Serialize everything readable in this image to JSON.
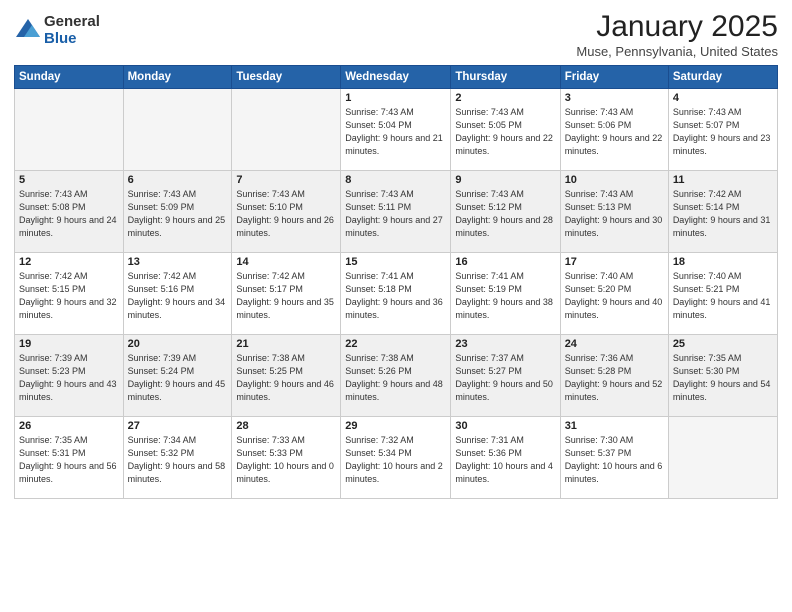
{
  "logo": {
    "general": "General",
    "blue": "Blue"
  },
  "header": {
    "title": "January 2025",
    "location": "Muse, Pennsylvania, United States"
  },
  "weekdays": [
    "Sunday",
    "Monday",
    "Tuesday",
    "Wednesday",
    "Thursday",
    "Friday",
    "Saturday"
  ],
  "weeks": [
    [
      {
        "day": "",
        "info": ""
      },
      {
        "day": "",
        "info": ""
      },
      {
        "day": "",
        "info": ""
      },
      {
        "day": "1",
        "info": "Sunrise: 7:43 AM\nSunset: 5:04 PM\nDaylight: 9 hours\nand 21 minutes."
      },
      {
        "day": "2",
        "info": "Sunrise: 7:43 AM\nSunset: 5:05 PM\nDaylight: 9 hours\nand 22 minutes."
      },
      {
        "day": "3",
        "info": "Sunrise: 7:43 AM\nSunset: 5:06 PM\nDaylight: 9 hours\nand 22 minutes."
      },
      {
        "day": "4",
        "info": "Sunrise: 7:43 AM\nSunset: 5:07 PM\nDaylight: 9 hours\nand 23 minutes."
      }
    ],
    [
      {
        "day": "5",
        "info": "Sunrise: 7:43 AM\nSunset: 5:08 PM\nDaylight: 9 hours\nand 24 minutes."
      },
      {
        "day": "6",
        "info": "Sunrise: 7:43 AM\nSunset: 5:09 PM\nDaylight: 9 hours\nand 25 minutes."
      },
      {
        "day": "7",
        "info": "Sunrise: 7:43 AM\nSunset: 5:10 PM\nDaylight: 9 hours\nand 26 minutes."
      },
      {
        "day": "8",
        "info": "Sunrise: 7:43 AM\nSunset: 5:11 PM\nDaylight: 9 hours\nand 27 minutes."
      },
      {
        "day": "9",
        "info": "Sunrise: 7:43 AM\nSunset: 5:12 PM\nDaylight: 9 hours\nand 28 minutes."
      },
      {
        "day": "10",
        "info": "Sunrise: 7:43 AM\nSunset: 5:13 PM\nDaylight: 9 hours\nand 30 minutes."
      },
      {
        "day": "11",
        "info": "Sunrise: 7:42 AM\nSunset: 5:14 PM\nDaylight: 9 hours\nand 31 minutes."
      }
    ],
    [
      {
        "day": "12",
        "info": "Sunrise: 7:42 AM\nSunset: 5:15 PM\nDaylight: 9 hours\nand 32 minutes."
      },
      {
        "day": "13",
        "info": "Sunrise: 7:42 AM\nSunset: 5:16 PM\nDaylight: 9 hours\nand 34 minutes."
      },
      {
        "day": "14",
        "info": "Sunrise: 7:42 AM\nSunset: 5:17 PM\nDaylight: 9 hours\nand 35 minutes."
      },
      {
        "day": "15",
        "info": "Sunrise: 7:41 AM\nSunset: 5:18 PM\nDaylight: 9 hours\nand 36 minutes."
      },
      {
        "day": "16",
        "info": "Sunrise: 7:41 AM\nSunset: 5:19 PM\nDaylight: 9 hours\nand 38 minutes."
      },
      {
        "day": "17",
        "info": "Sunrise: 7:40 AM\nSunset: 5:20 PM\nDaylight: 9 hours\nand 40 minutes."
      },
      {
        "day": "18",
        "info": "Sunrise: 7:40 AM\nSunset: 5:21 PM\nDaylight: 9 hours\nand 41 minutes."
      }
    ],
    [
      {
        "day": "19",
        "info": "Sunrise: 7:39 AM\nSunset: 5:23 PM\nDaylight: 9 hours\nand 43 minutes."
      },
      {
        "day": "20",
        "info": "Sunrise: 7:39 AM\nSunset: 5:24 PM\nDaylight: 9 hours\nand 45 minutes."
      },
      {
        "day": "21",
        "info": "Sunrise: 7:38 AM\nSunset: 5:25 PM\nDaylight: 9 hours\nand 46 minutes."
      },
      {
        "day": "22",
        "info": "Sunrise: 7:38 AM\nSunset: 5:26 PM\nDaylight: 9 hours\nand 48 minutes."
      },
      {
        "day": "23",
        "info": "Sunrise: 7:37 AM\nSunset: 5:27 PM\nDaylight: 9 hours\nand 50 minutes."
      },
      {
        "day": "24",
        "info": "Sunrise: 7:36 AM\nSunset: 5:28 PM\nDaylight: 9 hours\nand 52 minutes."
      },
      {
        "day": "25",
        "info": "Sunrise: 7:35 AM\nSunset: 5:30 PM\nDaylight: 9 hours\nand 54 minutes."
      }
    ],
    [
      {
        "day": "26",
        "info": "Sunrise: 7:35 AM\nSunset: 5:31 PM\nDaylight: 9 hours\nand 56 minutes."
      },
      {
        "day": "27",
        "info": "Sunrise: 7:34 AM\nSunset: 5:32 PM\nDaylight: 9 hours\nand 58 minutes."
      },
      {
        "day": "28",
        "info": "Sunrise: 7:33 AM\nSunset: 5:33 PM\nDaylight: 10 hours\nand 0 minutes."
      },
      {
        "day": "29",
        "info": "Sunrise: 7:32 AM\nSunset: 5:34 PM\nDaylight: 10 hours\nand 2 minutes."
      },
      {
        "day": "30",
        "info": "Sunrise: 7:31 AM\nSunset: 5:36 PM\nDaylight: 10 hours\nand 4 minutes."
      },
      {
        "day": "31",
        "info": "Sunrise: 7:30 AM\nSunset: 5:37 PM\nDaylight: 10 hours\nand 6 minutes."
      },
      {
        "day": "",
        "info": ""
      }
    ]
  ]
}
